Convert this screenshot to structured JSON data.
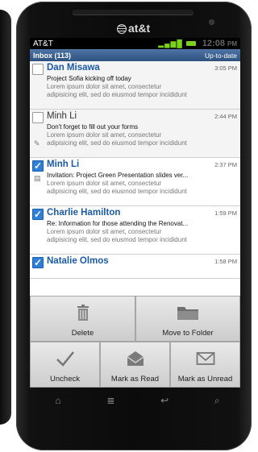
{
  "brand": "at&t",
  "status": {
    "carrier": "AT&T",
    "time": "12:08",
    "ampm": "PM"
  },
  "inbox": {
    "title": "Inbox (113)",
    "state": "Up-to-date"
  },
  "emails": [
    {
      "sender": "Dan Misawa",
      "time": "3:05 PM",
      "subject": "Project Sofia kicking off today",
      "preview1": "Lorem ipsum dolor sit amet, consectetur",
      "preview2": "adipisicing elit, sed do eiusmod tempor incididunt",
      "checked": false,
      "unread": true
    },
    {
      "sender": "Minh Li",
      "time": "2:44 PM",
      "subject": "Don't forget to fill out your forms",
      "preview1": "Lorem ipsum dolor sit amet, consectetur",
      "preview2": "adipisicing elit, sed do eiusmod tempor incididunt",
      "checked": false,
      "unread": false
    },
    {
      "sender": "Minh Li",
      "time": "2:37 PM",
      "subject": "Invitation: Project Green Presentation slides ver...",
      "preview1": "Lorem ipsum dolor sit amet, consectetur",
      "preview2": "adipisicing elit, sed do eiusmod tempor incididunt",
      "checked": true,
      "unread": true
    },
    {
      "sender": "Charlie Hamilton",
      "time": "1:59 PM",
      "subject": "Re: Information for those attending the Renovat...",
      "preview1": "Lorem ipsum dolor sit amet, consectetur",
      "preview2": "adipisicing elit, sed do eiusmod tempor incididunt",
      "checked": true,
      "unread": true
    },
    {
      "sender": "Natalie Olmos",
      "time": "1:58 PM",
      "subject": "",
      "preview1": "",
      "preview2": "",
      "checked": true,
      "unread": true
    }
  ],
  "actions": {
    "delete": "Delete",
    "move": "Move to Folder",
    "uncheck": "Uncheck",
    "mark_read": "Mark as Read",
    "mark_unread": "Mark as Unread"
  },
  "icons": {
    "attachment": "paperclip-icon",
    "calendar": "calendar-icon",
    "home": "home-icon",
    "menu": "menu-icon",
    "back": "back-icon",
    "search": "search-icon"
  },
  "colors": {
    "accent": "#2f7fd9",
    "header_bar": "#3d6394",
    "sender_unread": "#1a5aa8",
    "signal": "#7bd11c"
  }
}
